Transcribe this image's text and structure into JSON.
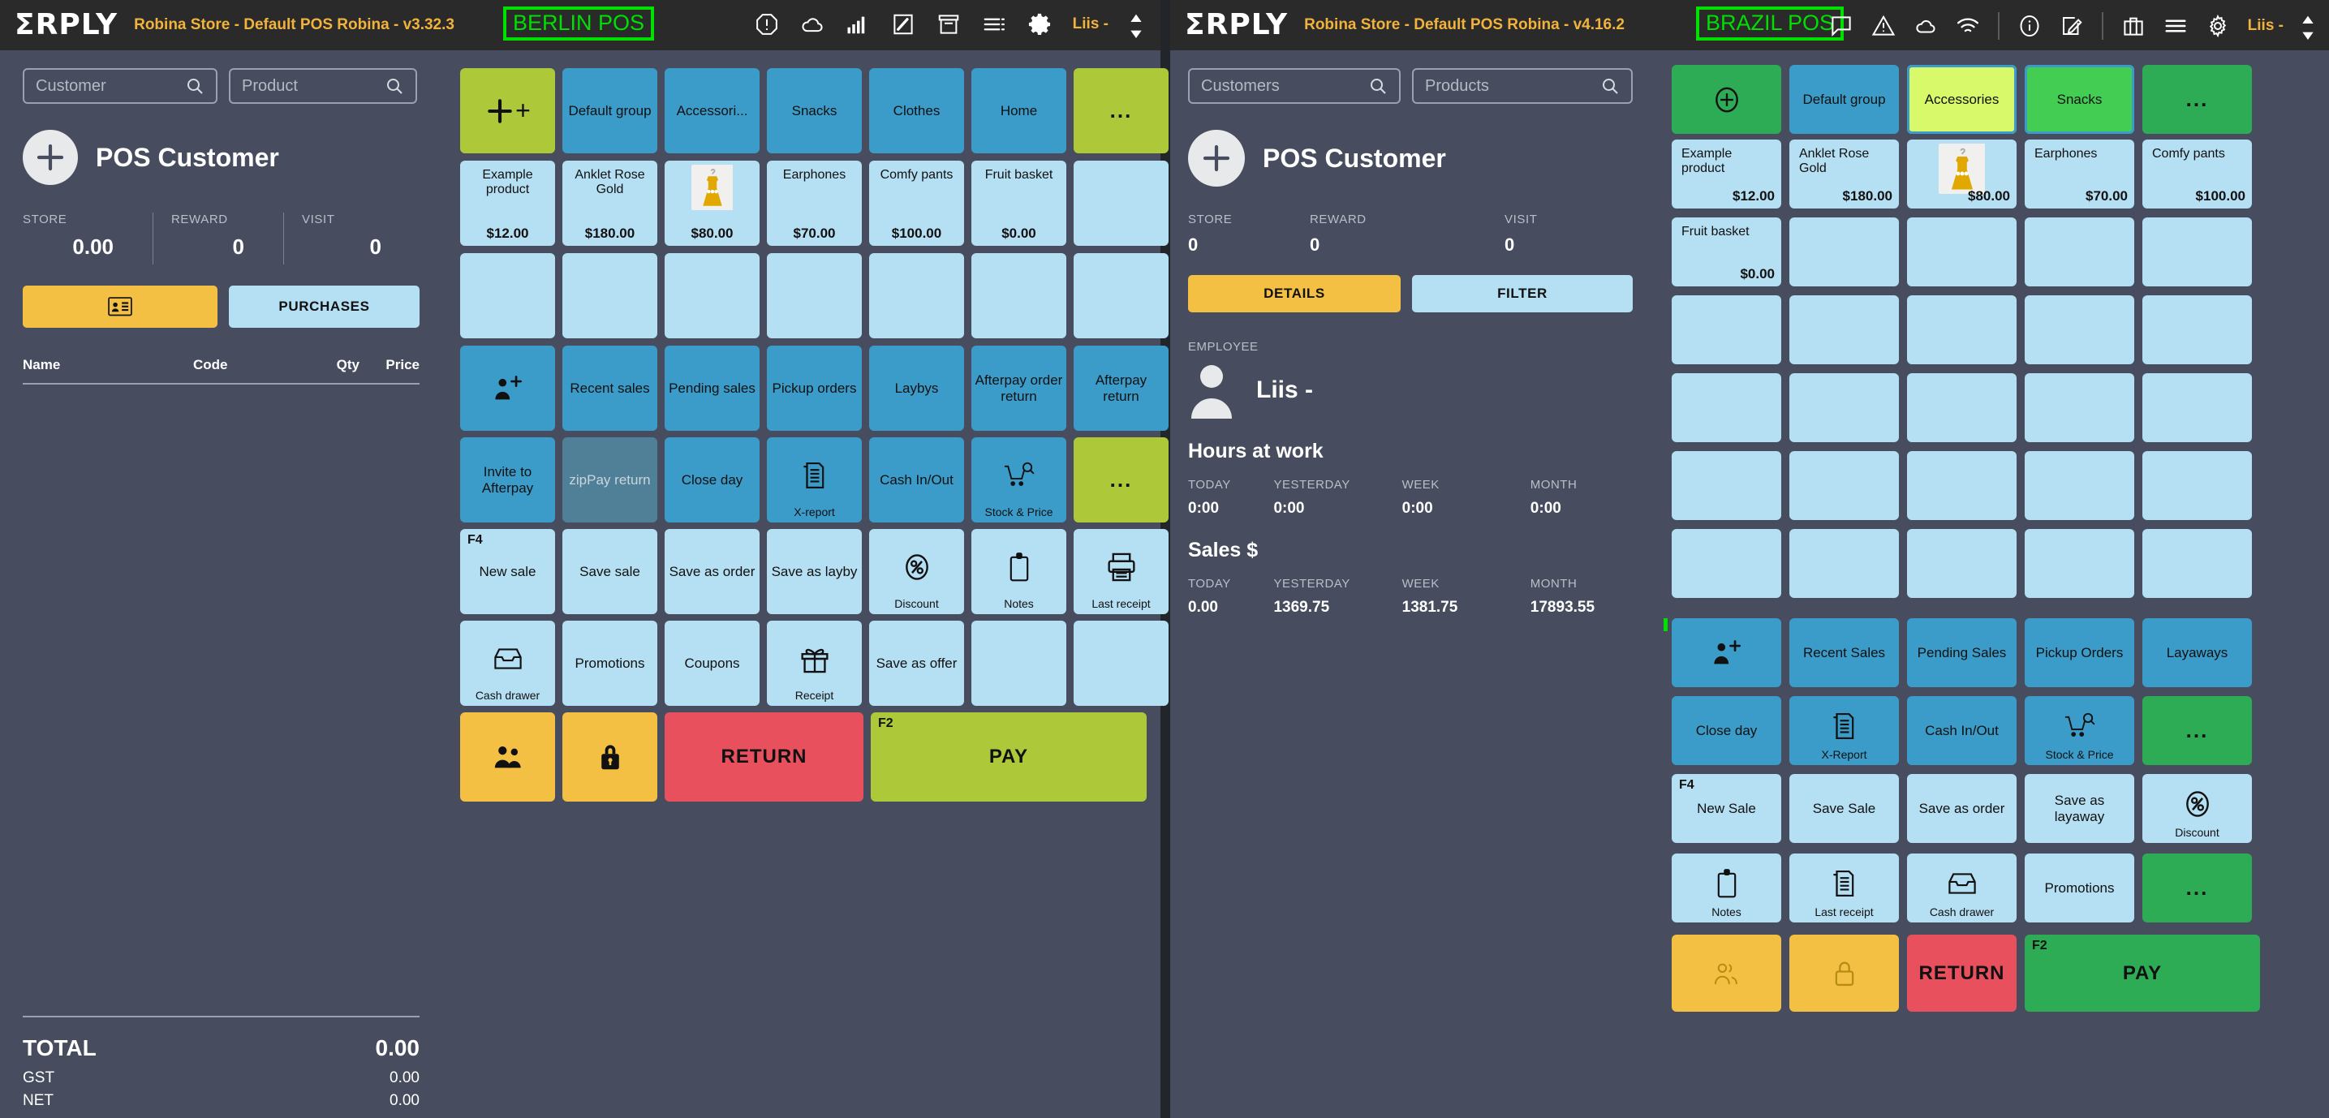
{
  "left_window": {
    "header": {
      "logo": "ΣRPLY",
      "store_title": "Robina Store - Default POS Robina - v3.32.3",
      "pos_badge": "BERLIN POS",
      "user": "Liis -",
      "icons": [
        "alert-octagon-icon",
        "cloud-icon",
        "signal-bars-icon",
        "pencil-square-icon",
        "archive-box-icon",
        "list-icon",
        "gear-icon"
      ]
    },
    "search": {
      "customer_placeholder": "Customer",
      "product_placeholder": "Product"
    },
    "customer": {
      "name": "POS Customer",
      "stats": [
        {
          "label": "STORE",
          "value": "0.00"
        },
        {
          "label": "REWARD",
          "value": "0"
        },
        {
          "label": "VISIT",
          "value": "0"
        }
      ],
      "details_icon": "id-card-icon",
      "purchases_label": "PURCHASES"
    },
    "cart": {
      "columns": [
        "Name",
        "Code",
        "Qty",
        "Price"
      ],
      "rows": []
    },
    "totals": [
      {
        "label": "TOTAL",
        "value": "0.00"
      },
      {
        "label": "GST",
        "value": "0.00"
      },
      {
        "label": "NET",
        "value": "0.00"
      }
    ],
    "groups": [
      {
        "label": "+",
        "color": "lime",
        "icon": "plus-icon"
      },
      {
        "label": "Default group",
        "color": "blue"
      },
      {
        "label": "Accessori...",
        "color": "blue"
      },
      {
        "label": "Snacks",
        "color": "blue"
      },
      {
        "label": "Clothes",
        "color": "blue"
      },
      {
        "label": "Home",
        "color": "blue"
      },
      {
        "label": "...",
        "color": "lime"
      }
    ],
    "products": [
      {
        "name": "Example product",
        "price": "$12.00"
      },
      {
        "name": "Anklet Rose Gold",
        "price": "$180.00"
      },
      {
        "name": "",
        "price": "$80.00",
        "thumb": "yellow-dress-photo"
      },
      {
        "name": "Earphones",
        "price": "$70.00"
      },
      {
        "name": "Comfy pants",
        "price": "$100.00"
      },
      {
        "name": "Fruit basket",
        "price": "$0.00"
      },
      {
        "name": "",
        "price": ""
      }
    ],
    "actions_row1": [
      {
        "label": "",
        "icon": "add-person-icon",
        "color": "blue"
      },
      {
        "label": "Recent sales",
        "color": "blue"
      },
      {
        "label": "Pending sales",
        "color": "blue"
      },
      {
        "label": "Pickup orders",
        "color": "blue"
      },
      {
        "label": "Laybys",
        "color": "blue"
      },
      {
        "label": "Afterpay order return",
        "color": "blue"
      },
      {
        "label": "Afterpay return",
        "color": "blue"
      }
    ],
    "actions_row2": [
      {
        "label": "Invite to Afterpay",
        "color": "blue"
      },
      {
        "label": "zipPay return",
        "color": "bluedim"
      },
      {
        "label": "Close day",
        "color": "blue"
      },
      {
        "label": "",
        "sub": "X-report",
        "icon": "report-icon",
        "color": "blue"
      },
      {
        "label": "Cash In/Out",
        "color": "blue"
      },
      {
        "label": "",
        "sub": "Stock & Price",
        "icon": "cart-search-icon",
        "color": "blue"
      },
      {
        "label": "...",
        "color": "lime"
      }
    ],
    "actions_row3": [
      {
        "label": "New sale",
        "fkey": "F4",
        "color": "lblue"
      },
      {
        "label": "Save sale",
        "color": "lblue"
      },
      {
        "label": "Save as order",
        "color": "lblue"
      },
      {
        "label": "Save as layby",
        "color": "lblue"
      },
      {
        "label": "",
        "sub": "Discount",
        "icon": "percent-icon",
        "color": "lblue"
      },
      {
        "label": "",
        "sub": "Notes",
        "icon": "notes-icon",
        "color": "lblue"
      },
      {
        "label": "",
        "sub": "Last receipt",
        "icon": "printer-icon",
        "color": "lblue"
      }
    ],
    "actions_row4": [
      {
        "label": "",
        "sub": "Cash drawer",
        "icon": "cash-drawer-icon",
        "color": "lblue"
      },
      {
        "label": "Promotions",
        "color": "lblue"
      },
      {
        "label": "Coupons",
        "color": "lblue"
      },
      {
        "label": "",
        "sub": "Receipt",
        "icon": "gift-icon",
        "color": "lblue"
      },
      {
        "label": "Save as offer",
        "color": "lblue"
      },
      {
        "label": "",
        "color": "lblue"
      },
      {
        "label": "",
        "color": "lblue"
      }
    ],
    "actions_row5": [
      {
        "label": "",
        "icon": "people-icon",
        "color": "yellow"
      },
      {
        "label": "",
        "icon": "lock-icon",
        "color": "yellow"
      },
      {
        "label": "RETURN",
        "color": "red"
      },
      {
        "label": "PAY",
        "fkey": "F2",
        "color": "lime"
      }
    ]
  },
  "right_window": {
    "header": {
      "logo": "ΣRPLY",
      "store_title": "Robina Store - Default POS Robina - v4.16.2",
      "pos_badge": "BRAZIL POS",
      "user": "Liis -",
      "icons": [
        "chat-bubble-icon",
        "warning-triangle-icon",
        "cloud-icon",
        "wifi-icon",
        "info-circle-icon",
        "edit-square-icon",
        "briefcase-icon",
        "hamburger-icon",
        "gear-icon"
      ]
    },
    "search": {
      "customer_placeholder": "Customers",
      "product_placeholder": "Products"
    },
    "customer": {
      "name": "POS Customer",
      "stats": [
        {
          "label": "STORE",
          "value": "0"
        },
        {
          "label": "REWARD",
          "value": "0"
        },
        {
          "label": "VISIT",
          "value": "0"
        }
      ],
      "details_label": "DETAILS",
      "filter_label": "FILTER"
    },
    "employee": {
      "section_label": "EMPLOYEE",
      "name": "Liis -",
      "hours_title": "Hours at work",
      "hours_cols": [
        "TODAY",
        "YESTERDAY",
        "WEEK",
        "MONTH"
      ],
      "hours_vals": [
        "0:00",
        "0:00",
        "0:00",
        "0:00"
      ],
      "sales_title": "Sales $",
      "sales_cols": [
        "TODAY",
        "YESTERDAY",
        "WEEK",
        "MONTH"
      ],
      "sales_vals": [
        "0.00",
        "1369.75",
        "1381.75",
        "17893.55"
      ]
    },
    "groups": [
      {
        "label": "",
        "color": "green",
        "icon": "plus-circle-icon"
      },
      {
        "label": "Default group",
        "color": "sblue"
      },
      {
        "label": "Accessories",
        "color": "lgreen",
        "selected": true
      },
      {
        "label": "Snacks",
        "color": "green2",
        "selected": true
      },
      {
        "label": "...",
        "color": "green"
      }
    ],
    "products": [
      {
        "name": "Example product",
        "price": "$12.00"
      },
      {
        "name": "Anklet Rose Gold",
        "price": "$180.00"
      },
      {
        "name": "",
        "price": "$80.00",
        "thumb": "yellow-dress-photo"
      },
      {
        "name": "Earphones",
        "price": "$70.00"
      },
      {
        "name": "Comfy pants",
        "price": "$100.00"
      },
      {
        "name": "Fruit basket",
        "price": "$0.00"
      }
    ],
    "actions_row1": [
      {
        "label": "",
        "icon": "add-person-icon",
        "color": "blue"
      },
      {
        "label": "Recent Sales",
        "color": "blue"
      },
      {
        "label": "Pending Sales",
        "color": "blue"
      },
      {
        "label": "Pickup Orders",
        "color": "blue"
      },
      {
        "label": "Layaways",
        "color": "blue"
      }
    ],
    "actions_row2": [
      {
        "label": "Close day",
        "color": "blue"
      },
      {
        "label": "",
        "sub": "X-Report",
        "icon": "report-icon",
        "color": "blue"
      },
      {
        "label": "Cash In/Out",
        "color": "blue"
      },
      {
        "label": "",
        "sub": "Stock & Price",
        "icon": "cart-search-icon",
        "color": "blue"
      },
      {
        "label": "...",
        "color": "green"
      }
    ],
    "actions_row3": [
      {
        "label": "New Sale",
        "fkey": "F4",
        "color": "lblue"
      },
      {
        "label": "Save Sale",
        "color": "lblue"
      },
      {
        "label": "Save as order",
        "color": "lblue"
      },
      {
        "label": "Save as layaway",
        "color": "lblue"
      },
      {
        "label": "",
        "sub": "Discount",
        "icon": "percent-icon",
        "color": "lblue"
      }
    ],
    "actions_row4": [
      {
        "label": "",
        "sub": "Notes",
        "icon": "notes-icon",
        "color": "lblue"
      },
      {
        "label": "",
        "sub": "Last receipt",
        "icon": "report-icon",
        "color": "lblue"
      },
      {
        "label": "",
        "sub": "Cash drawer",
        "icon": "cash-drawer-icon",
        "color": "lblue"
      },
      {
        "label": "Promotions",
        "color": "lblue"
      },
      {
        "label": "...",
        "color": "green"
      }
    ],
    "actions_row5": [
      {
        "label": "",
        "icon": "people-outline-icon",
        "color": "yellow"
      },
      {
        "label": "",
        "icon": "lock-outline-icon",
        "color": "yellow"
      },
      {
        "label": "RETURN",
        "color": "red"
      },
      {
        "label": "PAY",
        "fkey": "F2",
        "color": "green"
      }
    ]
  },
  "colors": {
    "panel_bg": "#474d5e",
    "topbar_bg": "#2a2a2a",
    "accent_yellow": "#f3c044",
    "accent_lime": "#adc93a",
    "accent_blue": "#3b9cc9",
    "accent_lightblue": "#b5dff2",
    "accent_red": "#e8505e",
    "accent_green": "#2eab55",
    "badge_green": "#00e000",
    "title_gold": "#f2b33d"
  }
}
